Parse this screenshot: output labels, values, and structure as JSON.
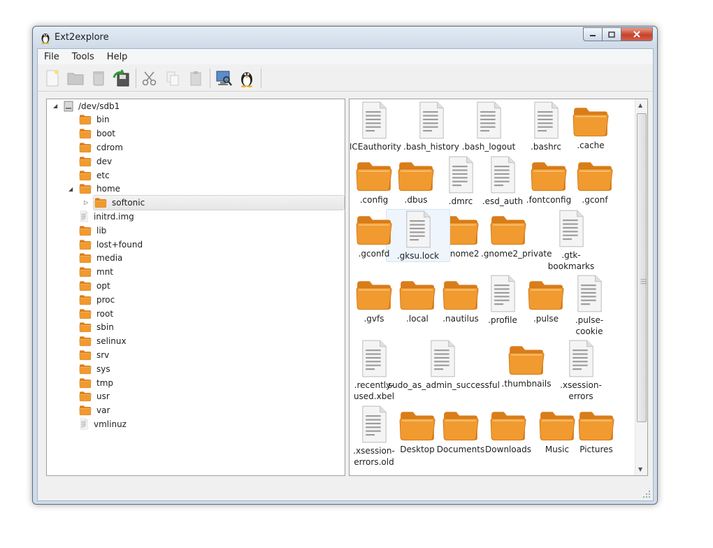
{
  "window": {
    "title": "Ext2explore",
    "icon": "tux-penguin-icon",
    "controls": [
      "minimize-icon",
      "maximize-icon",
      "close-icon"
    ]
  },
  "menu": [
    "File",
    "Tools",
    "Help"
  ],
  "toolbar": {
    "buttons": [
      {
        "name": "new-document-icon"
      },
      {
        "name": "folder-icon"
      },
      {
        "name": "trash-icon"
      },
      {
        "name": "save-arrow-icon"
      },
      {
        "name": "cut-icon"
      },
      {
        "name": "copy-icon"
      },
      {
        "name": "paste-icon"
      },
      {
        "name": "computer-search-icon"
      },
      {
        "name": "tux-penguin-icon"
      }
    ]
  },
  "tree": {
    "root": "/dev/sdb1",
    "items": [
      {
        "label": "bin",
        "type": "folder",
        "depth": 1
      },
      {
        "label": "boot",
        "type": "folder",
        "depth": 1
      },
      {
        "label": "cdrom",
        "type": "folder",
        "depth": 1
      },
      {
        "label": "dev",
        "type": "folder",
        "depth": 1
      },
      {
        "label": "etc",
        "type": "folder",
        "depth": 1
      },
      {
        "label": "home",
        "type": "folder",
        "depth": 1,
        "expanded": true
      },
      {
        "label": "softonic",
        "type": "folder",
        "depth": 2,
        "selected": true
      },
      {
        "label": "initrd.img",
        "type": "file",
        "depth": 1
      },
      {
        "label": "lib",
        "type": "folder",
        "depth": 1
      },
      {
        "label": "lost+found",
        "type": "folder",
        "depth": 1
      },
      {
        "label": "media",
        "type": "folder",
        "depth": 1
      },
      {
        "label": "mnt",
        "type": "folder",
        "depth": 1
      },
      {
        "label": "opt",
        "type": "folder",
        "depth": 1
      },
      {
        "label": "proc",
        "type": "folder",
        "depth": 1
      },
      {
        "label": "root",
        "type": "folder",
        "depth": 1
      },
      {
        "label": "sbin",
        "type": "folder",
        "depth": 1
      },
      {
        "label": "selinux",
        "type": "folder",
        "depth": 1
      },
      {
        "label": "srv",
        "type": "folder",
        "depth": 1
      },
      {
        "label": "sys",
        "type": "folder",
        "depth": 1
      },
      {
        "label": "tmp",
        "type": "folder",
        "depth": 1
      },
      {
        "label": "usr",
        "type": "folder",
        "depth": 1
      },
      {
        "label": "var",
        "type": "folder",
        "depth": 1
      },
      {
        "label": "vmlinuz",
        "type": "file",
        "depth": 1
      }
    ]
  },
  "icons": [
    {
      "label": ".ICEauthority",
      "type": "file"
    },
    {
      "label": ".bash_history",
      "type": "file"
    },
    {
      "label": ".bash_logout",
      "type": "file"
    },
    {
      "label": ".bashrc",
      "type": "file"
    },
    {
      "label": ".cache",
      "type": "folder"
    },
    {
      "label": ".config",
      "type": "folder"
    },
    {
      "label": ".dbus",
      "type": "folder"
    },
    {
      "label": ".dmrc",
      "type": "file"
    },
    {
      "label": ".esd_auth",
      "type": "file"
    },
    {
      "label": ".fontconfig",
      "type": "folder"
    },
    {
      "label": ".gconf",
      "type": "folder"
    },
    {
      "label": ".gconfd",
      "type": "folder"
    },
    {
      "label": ".gksu.lock",
      "type": "file",
      "highlighted": true
    },
    {
      "label": ".gnome2",
      "type": "folder"
    },
    {
      "label": ".gnome2_private",
      "type": "folder"
    },
    {
      "label": ".gtk-bookmarks",
      "type": "file"
    },
    {
      "label": ".gvfs",
      "type": "folder"
    },
    {
      "label": ".local",
      "type": "folder"
    },
    {
      "label": ".nautilus",
      "type": "folder"
    },
    {
      "label": ".profile",
      "type": "file"
    },
    {
      "label": ".pulse",
      "type": "folder"
    },
    {
      "label": ".pulse-cookie",
      "type": "file"
    },
    {
      "label": ".recently-used.xbel",
      "type": "file"
    },
    {
      "label": ".sudo_as_admin_successful",
      "type": "file"
    },
    {
      "label": ".thumbnails",
      "type": "folder"
    },
    {
      "label": ".xsession-errors",
      "type": "file"
    },
    {
      "label": ".xsession-errors.old",
      "type": "file"
    },
    {
      "label": "Desktop",
      "type": "folder"
    },
    {
      "label": "Documents",
      "type": "folder"
    },
    {
      "label": "Downloads",
      "type": "folder"
    },
    {
      "label": "Music",
      "type": "folder"
    },
    {
      "label": "Pictures",
      "type": "folder"
    }
  ],
  "colors": {
    "folder": "#f09a30",
    "folder_dark": "#d97d1a",
    "selection": "#e8e8e8"
  }
}
